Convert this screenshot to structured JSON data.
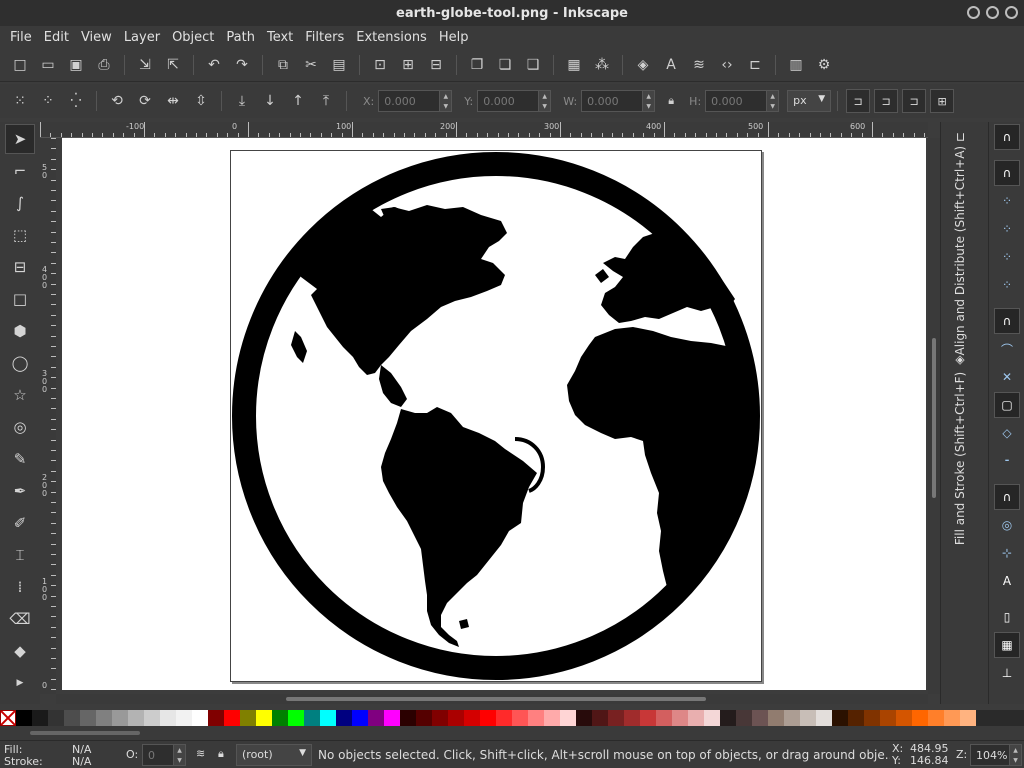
{
  "window": {
    "title": "earth-globe-tool.png - Inkscape"
  },
  "menu": [
    "File",
    "Edit",
    "View",
    "Layer",
    "Object",
    "Path",
    "Text",
    "Filters",
    "Extensions",
    "Help"
  ],
  "toolbar_icons": [
    "new-document-icon",
    "open-icon",
    "save-icon",
    "print-icon",
    "import-icon",
    "export-icon",
    "undo-icon",
    "redo-icon",
    "copy-icon",
    "cut-icon",
    "paste-icon",
    "zoom-selection-icon",
    "zoom-drawing-icon",
    "zoom-page-icon",
    "duplicate-icon",
    "clone-icon",
    "unlink-clone-icon",
    "group-icon",
    "ungroup-icon",
    "fill-stroke-icon",
    "text-font-icon",
    "layers-icon",
    "xml-editor-icon",
    "align-icon",
    "document-properties-icon",
    "preferences-icon"
  ],
  "select_toolbar": {
    "x_label": "X:",
    "x_value": "0.000",
    "y_label": "Y:",
    "y_value": "0.000",
    "w_label": "W:",
    "w_value": "0.000",
    "h_label": "H:",
    "h_value": "0.000",
    "unit": "px"
  },
  "rulers": {
    "h_labels": [
      "-100",
      "0",
      "100",
      "200",
      "300",
      "400",
      "500",
      "600"
    ],
    "v_labels": [
      "5\n0",
      "4\n0\n0",
      "3\n0\n0",
      "2\n0\n0",
      "1\n0\n0",
      "0"
    ]
  },
  "tools": [
    "selector-icon",
    "node-icon",
    "bezier-icon",
    "rect-select-icon",
    "measure-icon",
    "rect-icon",
    "3dbox-icon",
    "ellipse-icon",
    "star-icon",
    "spiral-icon",
    "pencil-icon",
    "pen-icon",
    "calligraphy-icon",
    "text-icon",
    "spray-icon",
    "eraser-icon",
    "bucket-icon",
    "expand-icon"
  ],
  "dock": {
    "align_tab": "Align and Distribute (Shift+Ctrl+A)",
    "fill_tab": "Fill and Stroke (Shift+Ctrl+F)"
  },
  "palette_colors": [
    "#000000",
    "#1a1a1a",
    "#333333",
    "#4d4d4d",
    "#666666",
    "#808080",
    "#999999",
    "#b3b3b3",
    "#cccccc",
    "#e6e6e6",
    "#f2f2f2",
    "#ffffff",
    "#800000",
    "#ff0000",
    "#808000",
    "#ffff00",
    "#008000",
    "#00ff00",
    "#008080",
    "#00ffff",
    "#000080",
    "#0000ff",
    "#800080",
    "#ff00ff",
    "#2b0000",
    "#550000",
    "#800000",
    "#aa0000",
    "#d40000",
    "#ff0000",
    "#ff2a2a",
    "#ff5555",
    "#ff8080",
    "#ffaaaa",
    "#ffd5d5",
    "#280b0b",
    "#501616",
    "#782121",
    "#a02c2c",
    "#c83737",
    "#d35f5f",
    "#de8787",
    "#e9afaf",
    "#f4d7d7",
    "#241c1c",
    "#483737",
    "#6c5353",
    "#917c6f",
    "#ac9d93",
    "#c8beb7",
    "#e3dedb",
    "#2b1100",
    "#552200",
    "#803300",
    "#aa4400",
    "#d45500",
    "#ff6600",
    "#ff7f2a",
    "#ff9955",
    "#ffb380"
  ],
  "status": {
    "fill_label": "Fill:",
    "fill_value": "N/A",
    "stroke_label": "Stroke:",
    "stroke_value": "N/A",
    "opacity_label": "O:",
    "opacity_value": "0",
    "layer": "(root)",
    "message": "No objects selected. Click, Shift+click, Alt+scroll mouse on top of objects, or drag around obje...",
    "x_label": "X:",
    "x_value": "484.95",
    "y_label": "Y:",
    "y_value": "146.84",
    "zoom_label": "Z:",
    "zoom_value": "104%"
  }
}
